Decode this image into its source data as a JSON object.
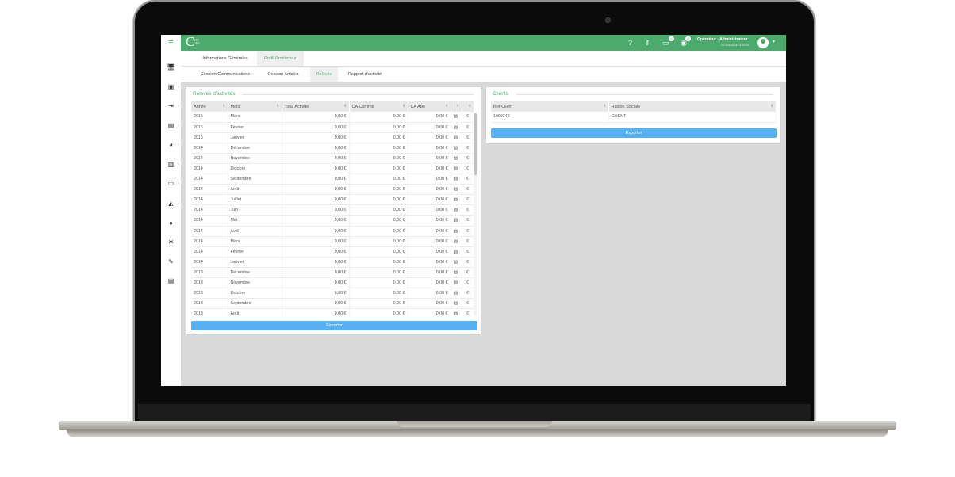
{
  "app": {
    "logo_letter": "C",
    "logo_sub": [
      "STE",
      "ORS"
    ]
  },
  "topbar": {
    "help_icon": "question-icon",
    "key_icon": "key-icon",
    "messages_badge": "0",
    "notifications_badge": "0",
    "user_name": "Opérateur - Administrateur",
    "user_date": "Le 03/10/2016 à 09:25"
  },
  "sidebar": {
    "items": [
      {
        "icon": "monitor-icon",
        "glyph": "🖥",
        "has_arrow": false
      },
      {
        "icon": "contacts-icon",
        "glyph": "▣",
        "has_arrow": true
      },
      {
        "icon": "login-icon",
        "glyph": "⇥",
        "has_arrow": true
      },
      {
        "icon": "calendar-icon",
        "glyph": "▤",
        "has_arrow": true
      },
      {
        "icon": "globe-icon",
        "glyph": "◕",
        "has_arrow": true
      },
      {
        "icon": "bar-chart-icon",
        "glyph": "▥",
        "has_arrow": true
      },
      {
        "icon": "money-icon",
        "glyph": "▭",
        "has_arrow": true
      },
      {
        "icon": "area-chart-icon",
        "glyph": "◭",
        "has_arrow": true
      },
      {
        "icon": "help-circle-icon",
        "glyph": "●",
        "has_arrow": false
      },
      {
        "icon": "gear-icon",
        "glyph": "✲",
        "has_arrow": false
      },
      {
        "icon": "pen-icon",
        "glyph": "✎",
        "has_arrow": false
      },
      {
        "icon": "document-icon",
        "glyph": "▤",
        "has_arrow": false
      }
    ]
  },
  "tabs_main": [
    {
      "label": "Informations Générales",
      "active": false
    },
    {
      "label": "Profil Producteur",
      "active": true
    }
  ],
  "tabs_sub": [
    {
      "label": "Cession Communications",
      "active": false
    },
    {
      "label": "Cession Articles",
      "active": false
    },
    {
      "label": "Relevés",
      "active": true
    },
    {
      "label": "Rapport d'activité",
      "active": false
    }
  ],
  "releves": {
    "title": "Relevés d'activités",
    "columns": [
      "Année",
      "Mois",
      "Total Activité",
      "CA Comme",
      "CA Abo",
      "",
      ""
    ],
    "rows": [
      [
        "2015",
        "Mars",
        "0,00 €",
        "0,00 €",
        "0,00 €"
      ],
      [
        "2015",
        "Février",
        "0,00 €",
        "0,00 €",
        "0,00 €"
      ],
      [
        "2015",
        "Janvier",
        "0,00 €",
        "0,00 €",
        "0,00 €"
      ],
      [
        "2014",
        "Décembre",
        "0,00 €",
        "0,00 €",
        "0,00 €"
      ],
      [
        "2014",
        "Novembre",
        "0,00 €",
        "0,00 €",
        "0,00 €"
      ],
      [
        "2014",
        "Octobre",
        "0,00 €",
        "0,00 €",
        "0,00 €"
      ],
      [
        "2014",
        "Septembre",
        "0,00 €",
        "0,00 €",
        "0,00 €"
      ],
      [
        "2014",
        "Août",
        "0,00 €",
        "0,00 €",
        "0,00 €"
      ],
      [
        "2014",
        "Juillet",
        "0,00 €",
        "0,00 €",
        "0,00 €"
      ],
      [
        "2014",
        "Juin",
        "0,00 €",
        "0,00 €",
        "0,00 €"
      ],
      [
        "2014",
        "Mai",
        "0,00 €",
        "0,00 €",
        "0,00 €"
      ],
      [
        "2014",
        "Avril",
        "0,00 €",
        "0,00 €",
        "0,00 €"
      ],
      [
        "2014",
        "Mars",
        "0,00 €",
        "0,00 €",
        "0,00 €"
      ],
      [
        "2014",
        "Février",
        "0,00 €",
        "0,00 €",
        "0,00 €"
      ],
      [
        "2014",
        "Janvier",
        "0,00 €",
        "0,00 €",
        "0,00 €"
      ],
      [
        "2013",
        "Décembre",
        "0,00 €",
        "0,00 €",
        "0,00 €"
      ],
      [
        "2013",
        "Novembre",
        "0,00 €",
        "0,00 €",
        "0,00 €"
      ],
      [
        "2013",
        "Octobre",
        "0,00 €",
        "0,00 €",
        "0,00 €"
      ],
      [
        "2013",
        "Septembre",
        "0,00 €",
        "0,00 €",
        "0,00 €"
      ],
      [
        "2013",
        "Août",
        "0,00 €",
        "0,00 €",
        "0,00 €"
      ]
    ],
    "row_icons": [
      "bar-chart-icon",
      "euro-icon"
    ],
    "euro_glyph": "€",
    "chart_glyph": "▥",
    "export_label": "Exporter"
  },
  "clients": {
    "title": "Clients",
    "columns": [
      "Ref Client",
      "Raison Sociale"
    ],
    "rows": [
      [
        "1000348",
        "CLIENT"
      ]
    ],
    "export_label": "Exporter"
  },
  "colors": {
    "brand_green": "#4daa6e",
    "export_blue": "#55b1f3",
    "background": "#d9d9d9"
  }
}
